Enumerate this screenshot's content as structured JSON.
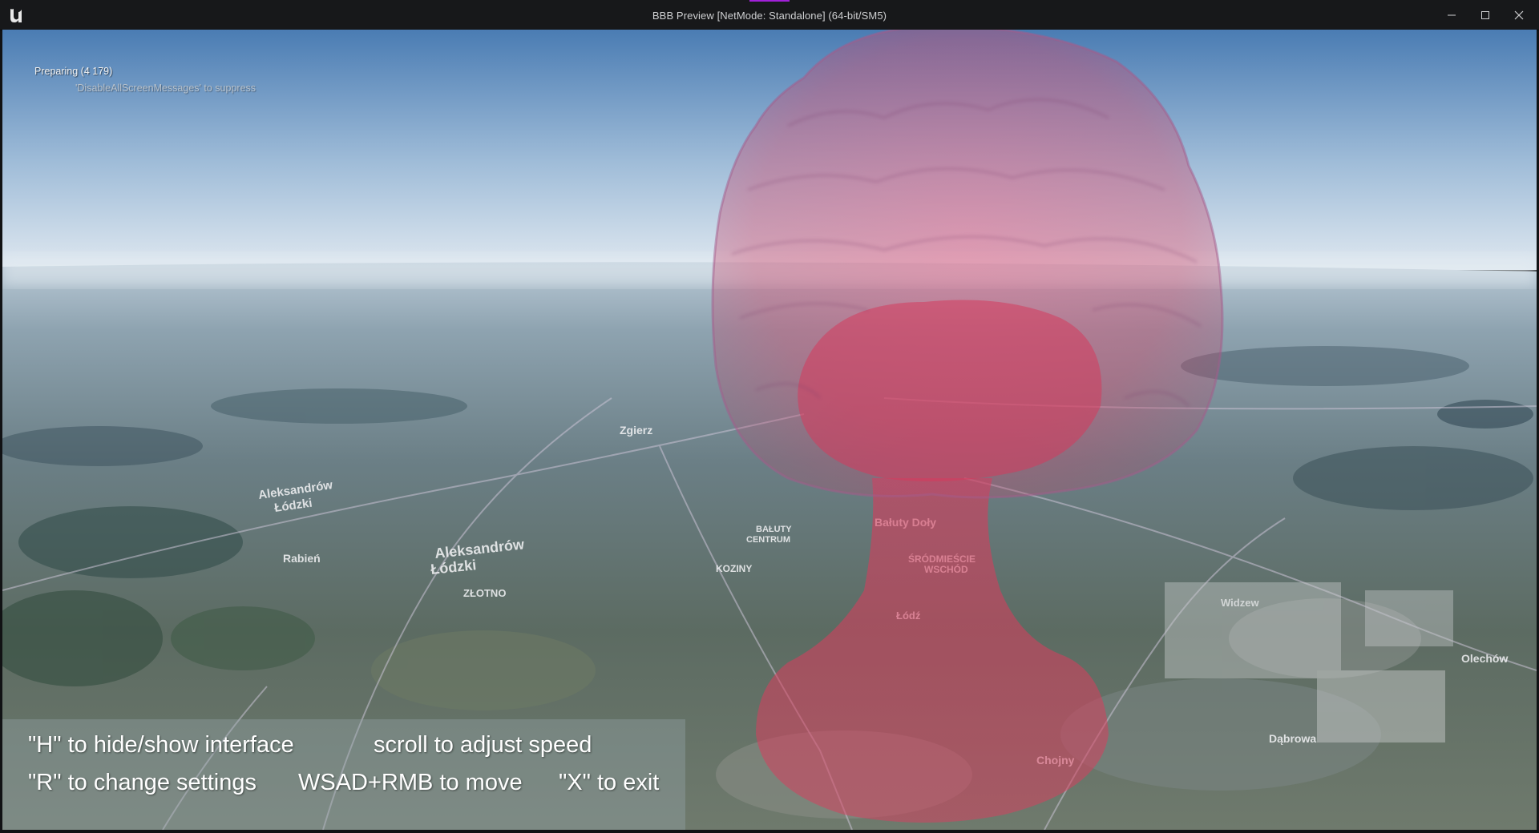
{
  "window": {
    "title": "BBB Preview [NetMode: Standalone]  (64-bit/SM5)",
    "logo": "unreal-engine-logo",
    "controls": [
      "minimize-icon",
      "maximize-icon",
      "close-icon"
    ]
  },
  "overlay": {
    "status_message": "Preparing  (4 179)",
    "suppress_hint": "'DisableAllScreenMessages' to suppress"
  },
  "help": {
    "hide_show": "\"H\" to hide/show interface",
    "scroll_speed": "scroll to adjust speed",
    "change_settings": "\"R\" to change settings",
    "move": "WSAD+RMB to move",
    "exit": "\"X\" to exit"
  },
  "map_labels": [
    "Aleksandrów Łódzki",
    "Aleksandrów Łódzki",
    "Rabień",
    "ZŁOTNO",
    "Bałuty Doły",
    "ŚRÓDMIEŚCIE WSCHÓD",
    "KOZINY",
    "BAŁUTY CENTRUM",
    "Łódź",
    "Chojny",
    "Dąbrowa",
    "Widzew",
    "Zgierz",
    "Olechów"
  ],
  "colors": {
    "titlebar": "#17181a",
    "accent": "#a120d8",
    "sky_top": "#4f7fb4",
    "sky_horizon": "#dbe5ef",
    "cloud": "#d9506f"
  }
}
